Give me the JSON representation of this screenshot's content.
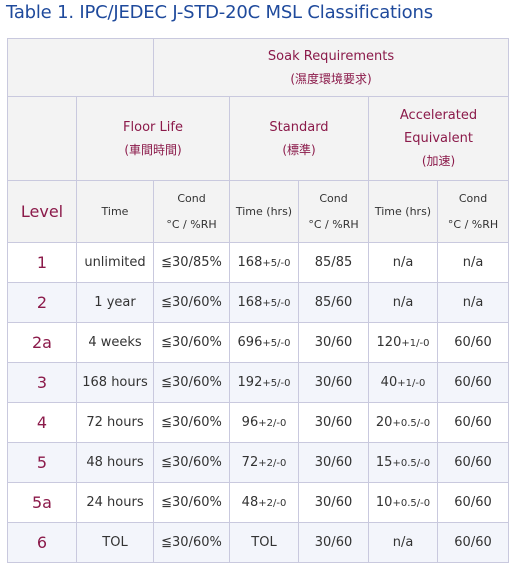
{
  "title": "Table 1. IPC/JEDEC J-STD-20C MSL Classifications",
  "headers": {
    "soak_label": "Soak Requirements",
    "soak_label_cn": "(濕度環境要求)",
    "floor_life": "Floor Life",
    "floor_life_cn": "(車間時間)",
    "standard": "Standard",
    "standard_cn": "(標準)",
    "accelerated": "Accelerated",
    "accelerated2": "Equivalent",
    "accelerated_cn": "(加速)",
    "level": "Level",
    "time": "Time",
    "cond": "Cond",
    "cond_unit": "°C / %RH",
    "time_hrs": "Time (hrs)"
  },
  "rows": [
    {
      "level": "1",
      "fl_time": "unlimited",
      "fl_cond": "≦30/85%",
      "std_time": "168",
      "std_tol": "+5/-0",
      "std_cond": "85/85",
      "acc_time": "n/a",
      "acc_tol": "",
      "acc_cond": "n/a"
    },
    {
      "level": "2",
      "fl_time": "1 year",
      "fl_cond": "≦30/60%",
      "std_time": "168",
      "std_tol": "+5/-0",
      "std_cond": "85/60",
      "acc_time": "n/a",
      "acc_tol": "",
      "acc_cond": "n/a"
    },
    {
      "level": "2a",
      "fl_time": "4 weeks",
      "fl_cond": "≦30/60%",
      "std_time": "696",
      "std_tol": "+5/-0",
      "std_cond": "30/60",
      "acc_time": "120",
      "acc_tol": "+1/-0",
      "acc_cond": "60/60"
    },
    {
      "level": "3",
      "fl_time": "168 hours",
      "fl_cond": "≦30/60%",
      "std_time": "192",
      "std_tol": "+5/-0",
      "std_cond": "30/60",
      "acc_time": "40",
      "acc_tol": "+1/-0",
      "acc_cond": "60/60"
    },
    {
      "level": "4",
      "fl_time": "72 hours",
      "fl_cond": "≦30/60%",
      "std_time": "96",
      "std_tol": "+2/-0",
      "std_cond": "30/60",
      "acc_time": "20",
      "acc_tol": "+0.5/-0",
      "acc_cond": "60/60"
    },
    {
      "level": "5",
      "fl_time": "48 hours",
      "fl_cond": "≦30/60%",
      "std_time": "72",
      "std_tol": "+2/-0",
      "std_cond": "30/60",
      "acc_time": "15",
      "acc_tol": "+0.5/-0",
      "acc_cond": "60/60"
    },
    {
      "level": "5a",
      "fl_time": "24 hours",
      "fl_cond": "≦30/60%",
      "std_time": "48",
      "std_tol": "+2/-0",
      "std_cond": "30/60",
      "acc_time": "10",
      "acc_tol": "+0.5/-0",
      "acc_cond": "60/60"
    },
    {
      "level": "6",
      "fl_time": "TOL",
      "fl_cond": "≦30/60%",
      "std_time": "TOL",
      "std_tol": "",
      "std_cond": "30/60",
      "acc_time": "n/a",
      "acc_tol": "",
      "acc_cond": "60/60"
    }
  ]
}
